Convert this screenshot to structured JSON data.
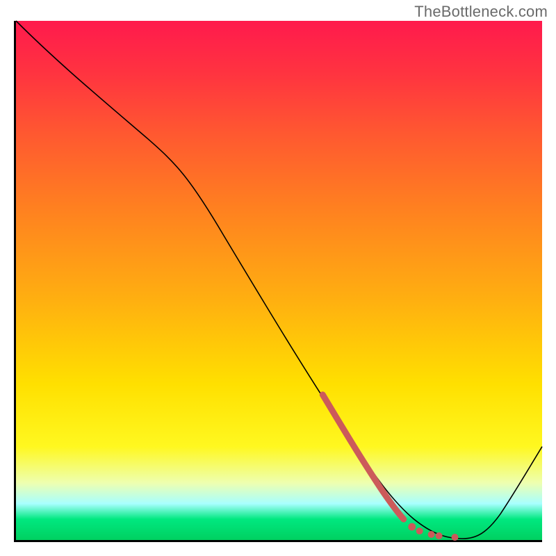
{
  "watermark": "TheBottleneck.com",
  "chart_data": {
    "type": "line",
    "title": "",
    "xlabel": "",
    "ylabel": "",
    "xlim": [
      0,
      100
    ],
    "ylim": [
      0,
      100
    ],
    "series": [
      {
        "name": "curve",
        "x": [
          0,
          15,
          25,
          40,
          55,
          68,
          72,
          76,
          80,
          84,
          100
        ],
        "values": [
          100,
          86,
          78,
          55,
          32,
          12,
          6,
          2,
          0,
          0,
          18
        ]
      }
    ],
    "highlight_segment": {
      "x_range": [
        58,
        72
      ],
      "description": "thick salmon dashed segment along descending portion near trough"
    },
    "highlight_dots": {
      "x": [
        73.5,
        76.5,
        78,
        82
      ],
      "y": [
        2.2,
        1.2,
        1.0,
        0.6
      ]
    },
    "gradient_background": {
      "top_color": "#ff1a4d",
      "bottom_color": "#00d060",
      "description": "vertical gradient red-orange-yellow-green"
    }
  }
}
